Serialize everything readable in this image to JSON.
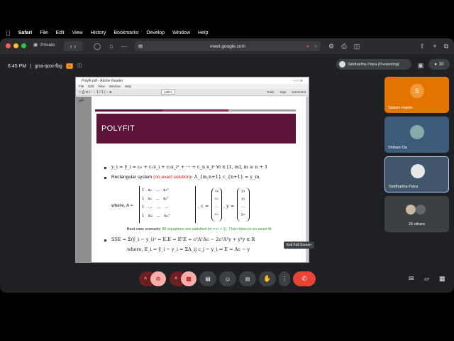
{
  "menubar": {
    "apple": "",
    "app": "Safari",
    "items": [
      "File",
      "Edit",
      "View",
      "History",
      "Bookmarks",
      "Develop",
      "Window",
      "Help"
    ]
  },
  "browser": {
    "private_label": "Private",
    "url": "meet.google.com"
  },
  "meet": {
    "time": "6:45 PM",
    "separator": "|",
    "meeting_code": "gna-qoxi-fbg",
    "presenter_chip": "Siddhartha Patra (Presenting)",
    "count": "30",
    "tooltip": "Exit Full Screen"
  },
  "pdf": {
    "window_title": "Polyfit.pdf - Adobe Reader",
    "menu": [
      "File",
      "Edit",
      "View",
      "Window",
      "Help"
    ],
    "zoom": "138%",
    "tools": [
      "Tools",
      "Sign",
      "Comment"
    ],
    "slide_title": "POLYFIT",
    "l1": "y_i ≈ ŷ_i = c₀ + c₁x_i + c₂x_i² + ··· + c_n x_iⁿ ∀i ∈ [1, m], m ≥ n + 1",
    "l2_a": "Rectangular system",
    "l2_b": "(no exact solution)",
    "l2_c": ": A_{m,n+1} c_{n+1} = y_m",
    "where_label": "where, A =",
    "matrix_rows": [
      "1   x₁   …   x₁ⁿ",
      "1   x₂   …   x₂ⁿ",
      "1   …    …   …",
      "1   xₘ   …   xₘⁿ"
    ],
    "c_label": ", c =",
    "c_vec": [
      "c₀",
      "c₁",
      "…",
      "cₙ"
    ],
    "y_label": ", y =",
    "y_vec": [
      "y₁",
      "y₂",
      "…",
      "yₘ"
    ],
    "best_a": "Best case scenario:",
    "best_b": "All equations are satisfied (m = n + 1). Then there is an exact fit",
    "sse": "SSE = Σ(ŷ_i − y_i)² = E.E = EᵀE = cᵀAᵀAc − 2cᵀAᵀy + yᵀy ∈ R",
    "ei": "where, E_i = ŷ_i − y_i = ΣA_ij c_j − y_i ⇒ E = Ac − y"
  },
  "tiles": [
    {
      "initial": "S",
      "name": "Sattam Halder",
      "color": "#e37400"
    },
    {
      "name": "Shibam De",
      "color": "#3c5a7a"
    },
    {
      "name": "Siddhartha Patra",
      "color": "#41556b"
    },
    {
      "name": "25 others",
      "color": "#3c4043"
    }
  ],
  "colors": {
    "banner": "#5c1338",
    "end_call": "#ea4335",
    "muted": "#6e1e1e"
  }
}
